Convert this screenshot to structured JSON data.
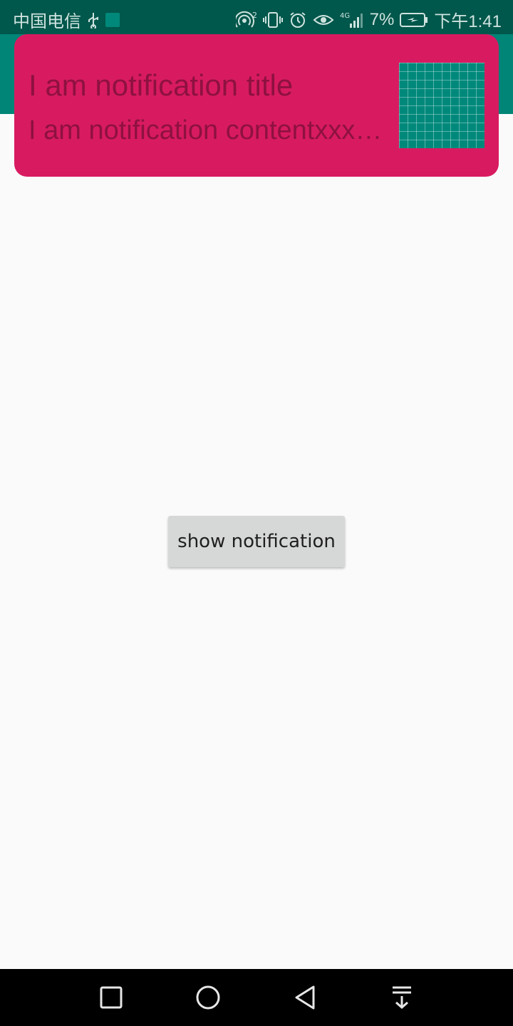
{
  "status_bar": {
    "carrier": "中国电信",
    "battery": "7%",
    "time": "下午1:41",
    "network": "4G",
    "icons": [
      "usb-icon",
      "app-icon",
      "hotspot-icon",
      "vibrate-icon",
      "alarm-icon",
      "eye-icon",
      "signal-icon",
      "battery-icon"
    ]
  },
  "app_bar": {
    "color": "#008577"
  },
  "notification": {
    "title": "I am notification title",
    "content": "I am notification contentxxxxxxxxxx",
    "background": "#d81b60",
    "text_color": "#8e1140",
    "image_icon": "grid-image-icon"
  },
  "main": {
    "button_label": "show notification"
  },
  "nav_bar": {
    "icons": [
      "recents-square-icon",
      "home-circle-icon",
      "back-triangle-icon",
      "notification-pull-icon"
    ]
  }
}
